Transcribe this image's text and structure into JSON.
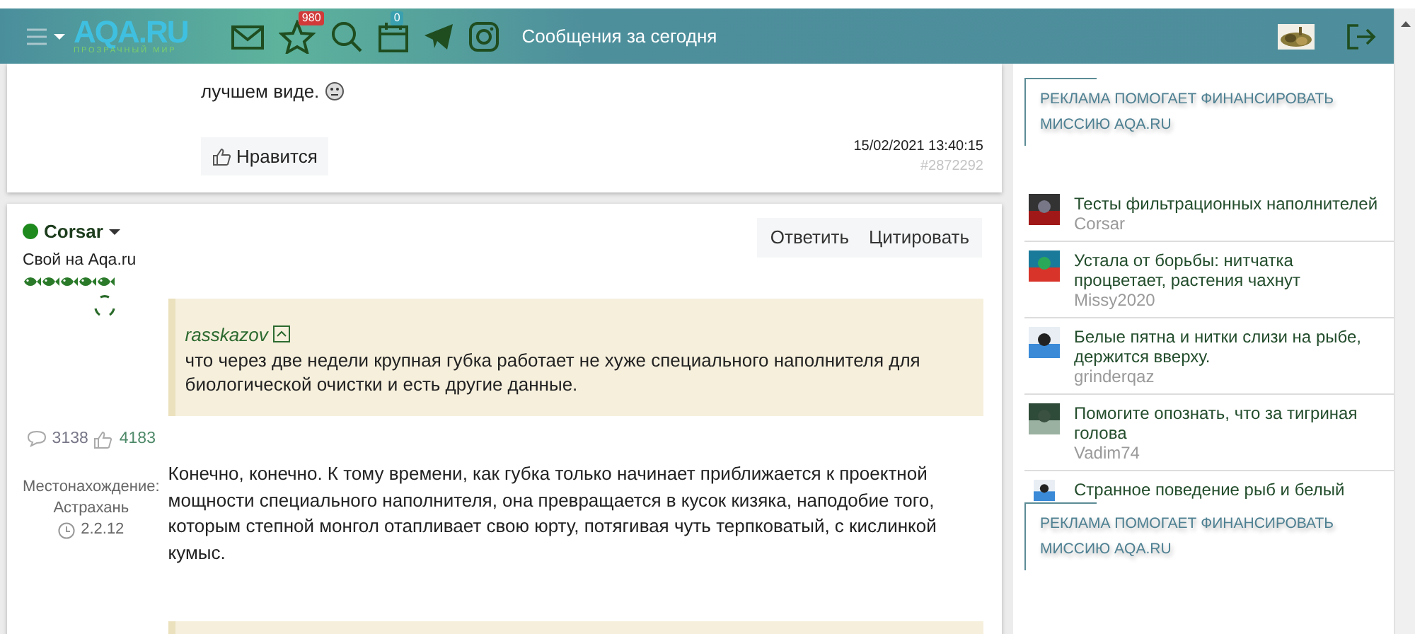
{
  "navbar": {
    "logo": "AQA.RU",
    "tagline": "ПРОЗРАЧНЫЙ МИР",
    "favorites_badge": "980",
    "calendar_badge": "0",
    "link": "Сообщения за сегодня"
  },
  "post_1": {
    "body": "лучшем виде.",
    "like_button": "Нравится",
    "date": "15/02/2021 13:40:15",
    "number": "#2872292"
  },
  "post_2": {
    "author": {
      "name": "Corsar",
      "online": true,
      "title": "Свой на Aqa.ru",
      "stars": 5,
      "messages": "3138",
      "likes": "4183",
      "location_label": "Местонахождение:",
      "location": "Астрахань",
      "since": "2.2.12"
    },
    "actions": [
      "Ответить",
      "Цитировать"
    ],
    "quote": {
      "author": "rasskazov",
      "text": "что через две недели крупная губка работает не хуже специального наполнителя для биологической очистки и есть другие данные."
    },
    "body": "Конечно, конечно. К тому времени, как губка только начинает приближается к проектной мощности специального наполнителя, она превращается в кусок кизяка, наподобие того, которым степной монгол отапливает свою юрту, потягивая чуть терпковатый, с кислинкой кумыс."
  },
  "sidebar": {
    "ads": [
      "РЕКЛАМА ПОМОГАЕТ ФИНАНСИРОВАТЬ МИССИЮ AQA.RU",
      "РЕКЛАМА ПОМОГАЕТ ФИНАНСИРОВАТЬ МИССИЮ AQA.RU"
    ],
    "topics": [
      {
        "title": "Тесты фильтрационных наполнителей",
        "author": "Corsar"
      },
      {
        "title": "Устала от борьбы: нитчатка процветает, растения чахнут",
        "author": "Missy2020"
      },
      {
        "title": "Белые пятна и нитки слизи на рыбе, держится вверху.",
        "author": "grinderqaz"
      },
      {
        "title": "Помогите опознать, что за тигриная голова",
        "author": "Vadim74"
      },
      {
        "title": "Странное поведение рыб и белый"
      }
    ]
  }
}
